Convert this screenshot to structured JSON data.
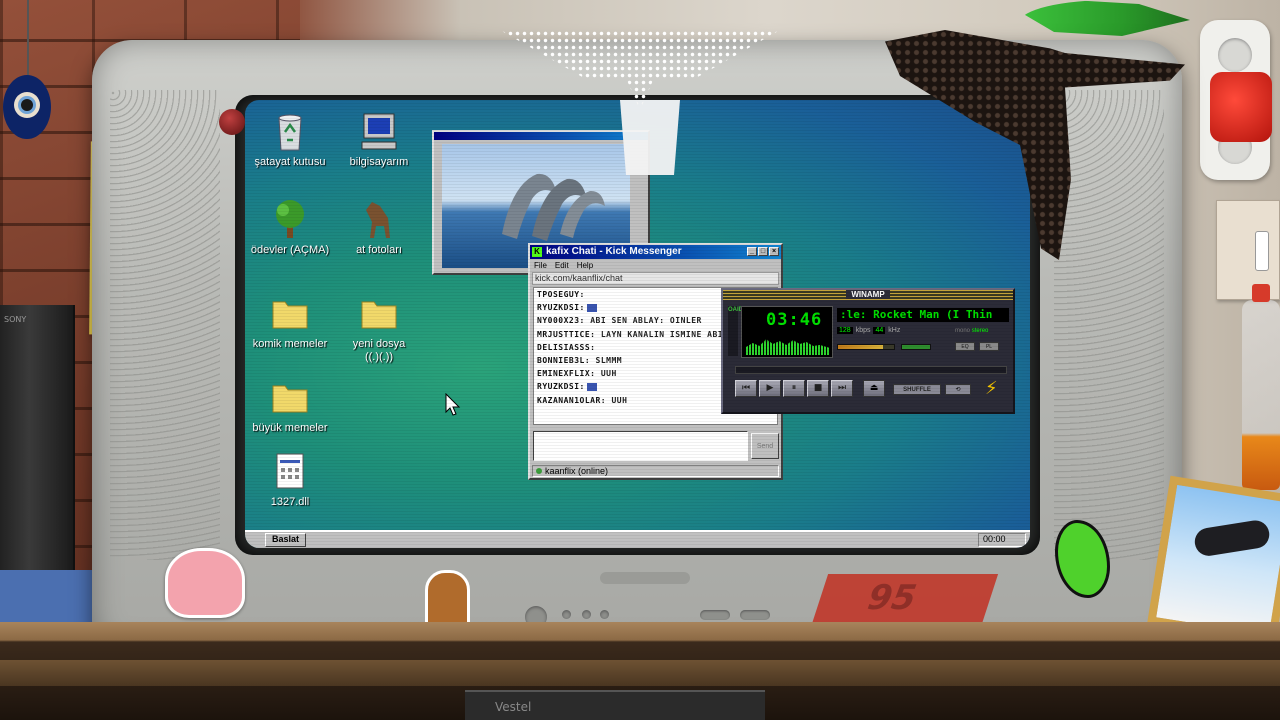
{
  "desktop": {
    "icons": [
      {
        "label": "şatayat kutusu"
      },
      {
        "label": "bilgisayarım"
      },
      {
        "label": "ödevler (AÇMA)"
      },
      {
        "label": "at fotoları"
      },
      {
        "label": "komik memeler"
      },
      {
        "label": "yeni dosya\n((.)(.))"
      },
      {
        "label": "büyük memeler"
      },
      {
        "label": "1327.dll"
      }
    ],
    "taskbar": {
      "start_label": "Baslat",
      "tray_text": "00:00"
    }
  },
  "messenger": {
    "title": "kafix Chati - Kick Messenger",
    "menu": [
      "File",
      "Edit",
      "Help"
    ],
    "url": "kick.com/kaanflix/chat",
    "messages": [
      {
        "user": "TPOSEGUY:",
        "text": ""
      },
      {
        "user": "RYUZKDSI:",
        "text": "",
        "emote": true
      },
      {
        "user": "NY000X23:",
        "text": "ABI SEN ABLAY: OINLER"
      },
      {
        "user": "MRJUSTTICE:",
        "text": "LAYN KANALIN ISMINE ABI"
      },
      {
        "user": "DELISIASSS:",
        "text": ""
      },
      {
        "user": "BONNIEB3L:",
        "text": "SLMMM"
      },
      {
        "user": "EMINEXFLIX:",
        "text": "UUH"
      },
      {
        "user": "RYUZKDSI:",
        "text": "",
        "emote": true
      },
      {
        "user": "KAZANAN1OLAR:",
        "text": "UUH"
      }
    ],
    "status": "kaanflix (online)",
    "send_label": "Send"
  },
  "winamp": {
    "title": "WINAMP",
    "time": "03:46",
    "song": ":le: Rocket Man (I Thin",
    "kbps": "128",
    "kbps_label": "kbps",
    "khz": "44",
    "khz_label": "kHz",
    "mono_label": "mono",
    "stereo_label": "stereo",
    "eq_label": "EQ",
    "pl_label": "PL",
    "shuffle_label": "SHUFFLE",
    "side_label": "OAIDV",
    "volume": 0.8,
    "controls": [
      "previous",
      "play",
      "pause",
      "stop",
      "next"
    ]
  },
  "room": {
    "vcr_label": "Vestel",
    "console_label": "SONY",
    "sticker_text": "95"
  },
  "colors": {
    "desktop_teal": "#1e8f7a",
    "titlebar_blue": "#000080",
    "winamp_green": "#00e000",
    "kick_green": "#53fc18"
  }
}
